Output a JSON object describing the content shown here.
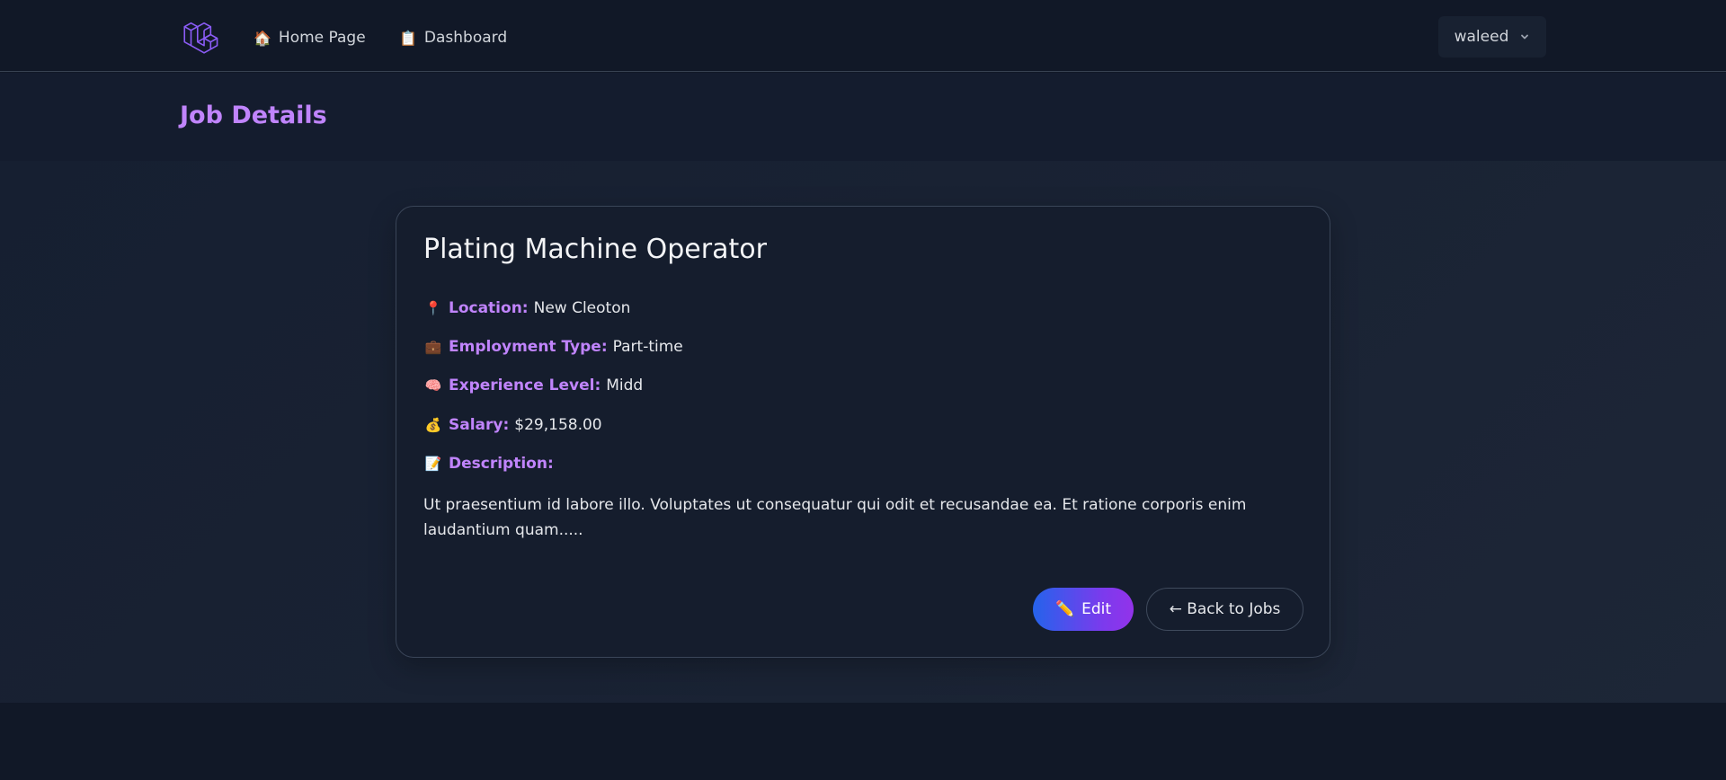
{
  "nav": {
    "logo_icon": "laravel-logo-icon",
    "links": [
      {
        "icon": "🏠",
        "label": "Home Page"
      },
      {
        "icon": "📋",
        "label": "Dashboard"
      }
    ],
    "user": {
      "name": "waleed",
      "icon": "chevron-down-icon"
    }
  },
  "header": {
    "title": "Job Details"
  },
  "job": {
    "title": "Plating Machine Operator",
    "fields": [
      {
        "icon": "📍",
        "label": "Location:",
        "value": "New Cleoton"
      },
      {
        "icon": "💼",
        "label": "Employment Type:",
        "value": "Part-time"
      },
      {
        "icon": "🧠",
        "label": "Experience Level:",
        "value": "Midd"
      },
      {
        "icon": "💰",
        "label": "Salary:",
        "value": "$29,158.00"
      },
      {
        "icon": "📝",
        "label": "Description:",
        "value": ""
      }
    ],
    "description": "Ut praesentium id labore illo. Voluptates ut consequatur qui odit et recusandae ea. Et ratione corporis enim laudantium quam.....",
    "edit": {
      "icon": "✏️",
      "label": "Edit"
    },
    "back_label": "← Back to Jobs"
  },
  "colors": {
    "accent": "#c084fc",
    "edit_gradient_start": "#2563eb",
    "edit_gradient_end": "#9333ea",
    "background": "#111827"
  }
}
